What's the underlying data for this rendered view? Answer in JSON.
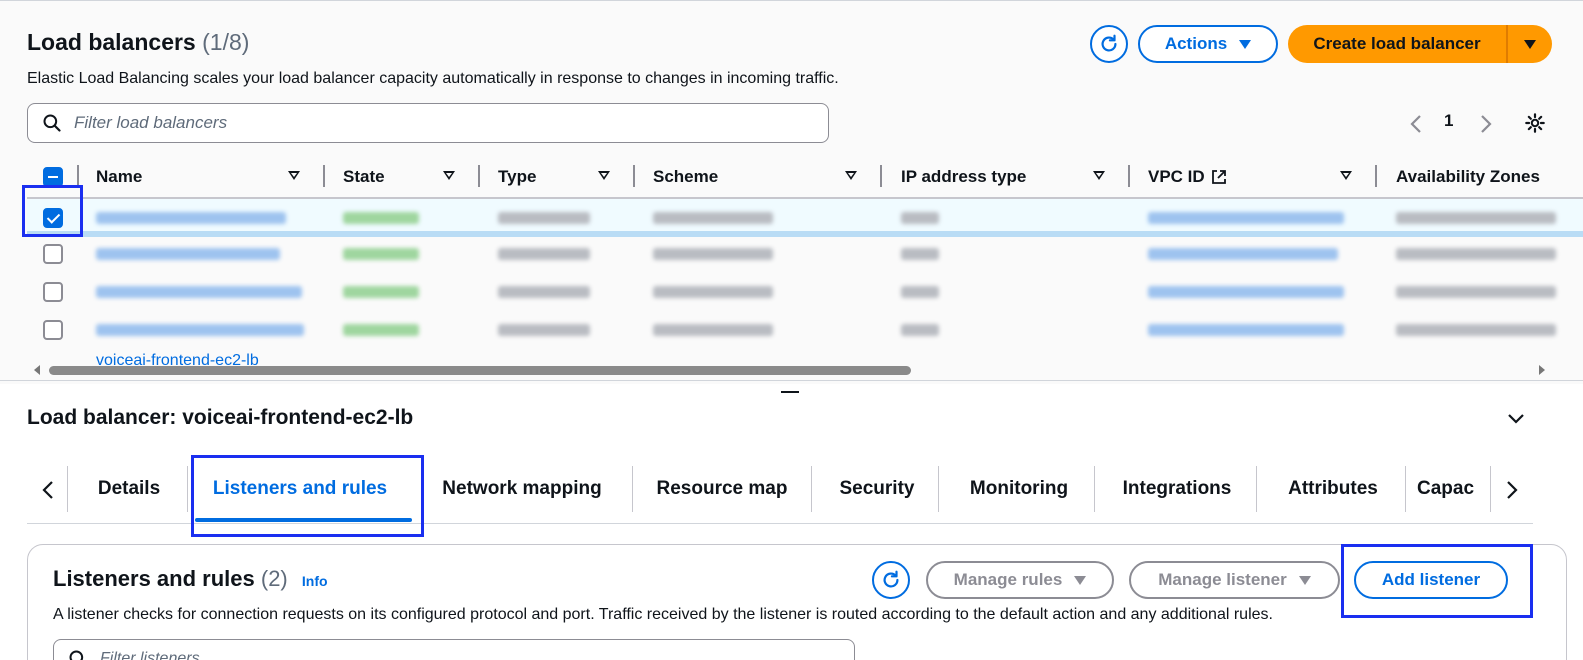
{
  "list": {
    "title": "Load balancers",
    "count": "(1/8)",
    "description": "Elastic Load Balancing scales your load balancer capacity automatically in response to changes in incoming traffic.",
    "actions_label": "Actions",
    "create_label": "Create load balancer",
    "filter_placeholder": "Filter load balancers",
    "page": "1",
    "columns": [
      "Name",
      "State",
      "Type",
      "Scheme",
      "IP address type",
      "VPC ID",
      "Availability Zones"
    ],
    "partial_row_text": "voiceai-frontend-ec2-lb"
  },
  "details": {
    "title": "Load balancer: voiceai-frontend-ec2-lb",
    "tabs": [
      "Details",
      "Listeners and rules",
      "Network mapping",
      "Resource map",
      "Security",
      "Monitoring",
      "Integrations",
      "Attributes",
      "Capac"
    ],
    "active_tab": "Listeners and rules"
  },
  "listeners": {
    "title": "Listeners and rules",
    "count": "(2)",
    "info": "Info",
    "manage_rules_label": "Manage rules",
    "manage_listener_label": "Manage listener",
    "add_listener_label": "Add listener",
    "description": "A listener checks for connection requests on its configured protocol and port. Traffic received by the listener is routed according to the default action and any additional rules.",
    "filter_placeholder": "Filter listeners"
  },
  "colors": {
    "link": "#006ce0",
    "primary": "#ff9900",
    "annotation_box": "#1a2ff0"
  }
}
